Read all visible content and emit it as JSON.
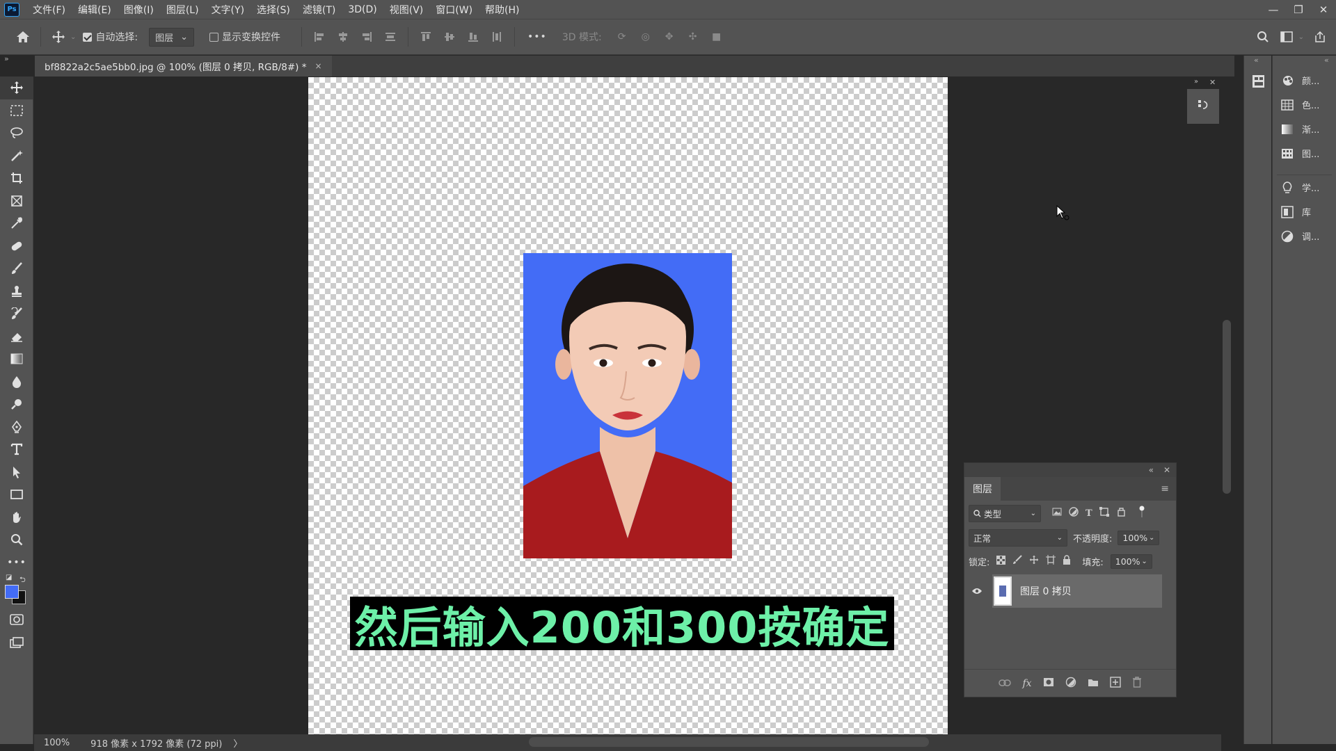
{
  "menu": {
    "logo": "Ps",
    "items": [
      "文件(F)",
      "编辑(E)",
      "图像(I)",
      "图层(L)",
      "文字(Y)",
      "选择(S)",
      "滤镜(T)",
      "3D(D)",
      "视图(V)",
      "窗口(W)",
      "帮助(H)"
    ]
  },
  "options": {
    "auto_select_label": "自动选择:",
    "auto_select_value": "图层",
    "show_transform_label": "显示变换控件",
    "mode_3d_label": "3D 模式:",
    "more": "•••"
  },
  "document": {
    "tab_title": "bf8822a2c5ae5bb0.jpg @ 100% (图层 0 拷贝, RGB/8#) *",
    "close": "×"
  },
  "canvas": {
    "subtitle": "然后输入200和300按确定",
    "photo_bg": "#436cf6",
    "subtitle_color": "#6df0a8"
  },
  "right_panels": [
    {
      "icon": "color-icon",
      "label": "颜..."
    },
    {
      "icon": "swatches-icon",
      "label": "色..."
    },
    {
      "icon": "gradient-icon",
      "label": "渐..."
    },
    {
      "icon": "patterns-icon",
      "label": "图..."
    },
    {
      "icon": "learn-icon",
      "label": "学..."
    },
    {
      "icon": "libraries-icon",
      "label": "库"
    },
    {
      "icon": "adjustments-icon",
      "label": "调..."
    }
  ],
  "layers_panel": {
    "tab": "图层",
    "filter_label": "类型",
    "blend_mode": "正常",
    "opacity_label": "不透明度:",
    "opacity_value": "100%",
    "lock_label": "锁定:",
    "fill_label": "填充:",
    "fill_value": "100%",
    "layer_name": "图层 0 拷贝"
  },
  "status": {
    "zoom": "100%",
    "dimensions": "918 像素 x 1792 像素 (72 ppi)",
    "arrow": "〉"
  }
}
